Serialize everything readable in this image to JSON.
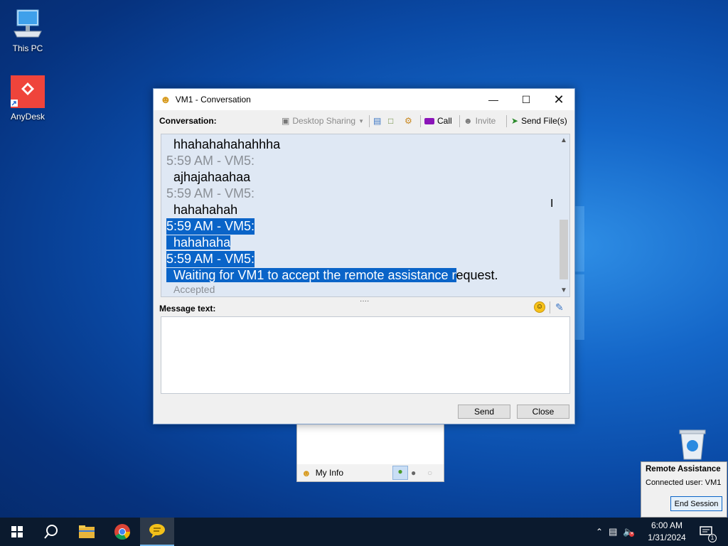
{
  "desktop": {
    "icons": [
      {
        "name": "this-pc",
        "label": "This PC"
      },
      {
        "name": "anydesk",
        "label": "AnyDesk"
      }
    ]
  },
  "window": {
    "title": "VM1 - Conversation",
    "toolbar": {
      "conversation_label": "Conversation:",
      "desktop_sharing": "Desktop Sharing",
      "call": "Call",
      "invite": "Invite",
      "send_files": "Send File(s)"
    },
    "chat": [
      {
        "type": "msg",
        "text": "hhahahahahahhha",
        "selected": false
      },
      {
        "type": "hdr",
        "text": "5:59 AM - VM5:",
        "selected": false
      },
      {
        "type": "msg",
        "text": "ajhajahaahaa",
        "selected": false
      },
      {
        "type": "hdr",
        "text": "5:59 AM - VM5:",
        "selected": false
      },
      {
        "type": "msg",
        "text": "hahahahah",
        "selected": false
      },
      {
        "type": "hdr",
        "text": "5:59 AM - VM5:",
        "selected": true
      },
      {
        "type": "msg",
        "text": "hahahaha",
        "selected": true
      },
      {
        "type": "hdr",
        "text": "5:59 AM - VM5:",
        "selected": true
      },
      {
        "type": "msg_partial",
        "selected_text": "Waiting for VM1 to accept the remote assistance r",
        "rest_text": "equest."
      }
    ],
    "accepted": "Accepted",
    "message_label": "Message text:",
    "message_value": "",
    "send_button": "Send",
    "close_button": "Close"
  },
  "contacts": {
    "my_info": "My Info"
  },
  "remote_assistance": {
    "title": "Remote Assistance",
    "connected_user": "Connected user: VM1",
    "end_session": "End Session"
  },
  "taskbar": {
    "time": "6:00 AM",
    "date": "1/31/2024",
    "notification_count": "1"
  },
  "colors": {
    "selection": "#0a64c8",
    "taskbar": "#0b1a2e",
    "chat_bg": "#dfe8f4"
  }
}
